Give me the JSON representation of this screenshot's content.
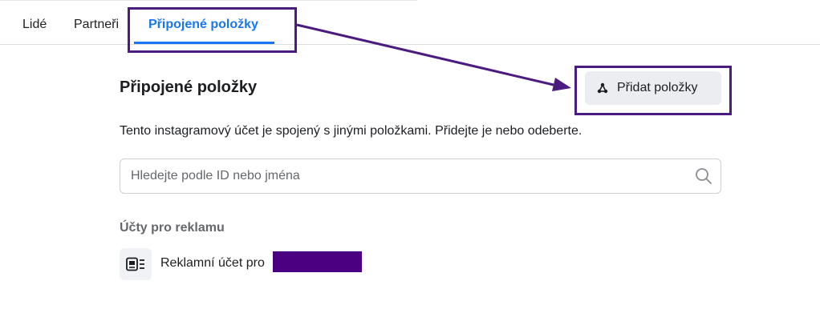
{
  "tabs": [
    {
      "label": "Lidé",
      "active": false
    },
    {
      "label": "Partneři",
      "active": false
    },
    {
      "label": "Připojené položky",
      "active": true
    }
  ],
  "section": {
    "title": "Připojené položky",
    "add_button_label": "Přidat položky",
    "description": "Tento instagramový účet je spojený s jinými položkami. Přidejte je nebo odeberte."
  },
  "search": {
    "placeholder": "Hledejte podle ID nebo jména",
    "value": ""
  },
  "ad_accounts": {
    "title": "Účty pro reklamu",
    "items": [
      {
        "label": "Reklamní účet pro",
        "name_redacted": true
      }
    ]
  },
  "colors": {
    "accent": "#1877f2",
    "annotation": "#4b1b80",
    "redaction": "#4b0082"
  },
  "icons": {
    "add_button": "connect-nodes-icon",
    "search": "search-icon",
    "ad_account": "ad-account-icon"
  }
}
